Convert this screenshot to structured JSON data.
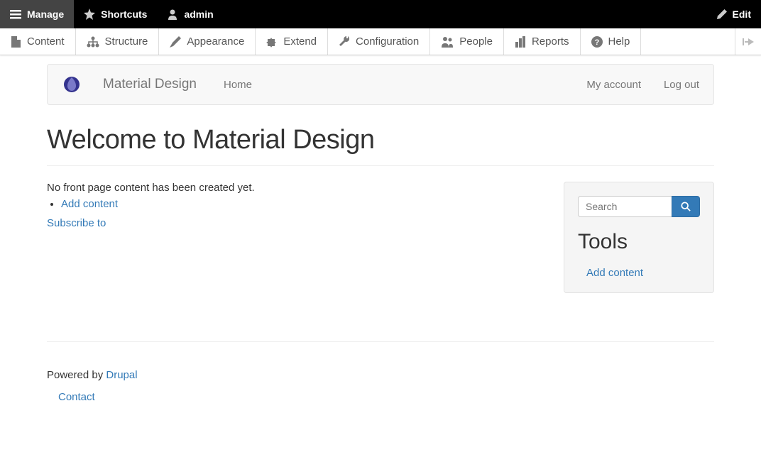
{
  "topbar": {
    "manage": "Manage",
    "shortcuts": "Shortcuts",
    "admin": "admin",
    "edit": "Edit"
  },
  "adminbar": {
    "content": "Content",
    "structure": "Structure",
    "appearance": "Appearance",
    "extend": "Extend",
    "configuration": "Configuration",
    "people": "People",
    "reports": "Reports",
    "help": "Help"
  },
  "site": {
    "name": "Material Design",
    "nav_home": "Home",
    "my_account": "My account",
    "logout": "Log out"
  },
  "page": {
    "title": "Welcome to Material Design",
    "no_content": "No front page content has been created yet.",
    "add_content": "Add content",
    "subscribe": "Subscribe to"
  },
  "sidebar": {
    "search_placeholder": "Search",
    "tools_heading": "Tools",
    "add_content": "Add content"
  },
  "footer": {
    "powered_by": "Powered by ",
    "drupal": "Drupal",
    "contact": "Contact"
  }
}
